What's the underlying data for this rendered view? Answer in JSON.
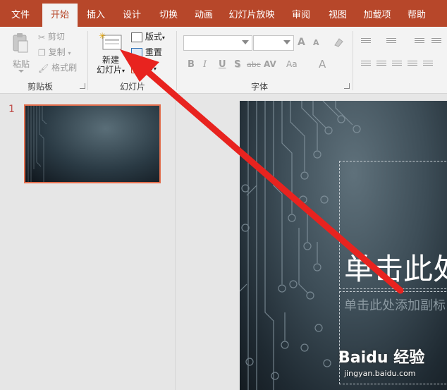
{
  "tabs": [
    "文件",
    "开始",
    "插入",
    "设计",
    "切换",
    "动画",
    "幻灯片放映",
    "审阅",
    "视图",
    "加载项",
    "帮助"
  ],
  "active_tab": "开始",
  "clipboard": {
    "paste_label": "粘贴",
    "cut_label": "剪切",
    "copy_label": "复制",
    "format_painter_label": "格式刷",
    "group_label": "剪贴板"
  },
  "slides_group": {
    "new_slide_line1": "新建",
    "new_slide_line2": "幻灯片",
    "layout_label": "版式",
    "reset_label": "重置",
    "section_label": "节",
    "group_label": "幻灯片"
  },
  "font_group": {
    "group_label": "字体",
    "bold": "B",
    "italic": "I",
    "underline": "U",
    "shadow": "S",
    "strike": "abc",
    "spacing": "AV",
    "case": "Aa",
    "color": "A",
    "grow": "A",
    "shrink": "A"
  },
  "thumbnails": [
    {
      "number": "1"
    }
  ],
  "slide": {
    "title_placeholder": "单击此处",
    "subtitle_placeholder": "单击此处添加副标"
  },
  "watermark": {
    "brand": "Baidu 经验",
    "url": "jingyan.baidu.com"
  },
  "colors": {
    "accent": "#b7472a",
    "arrow": "#e8231f",
    "selection": "#e36f4e"
  }
}
